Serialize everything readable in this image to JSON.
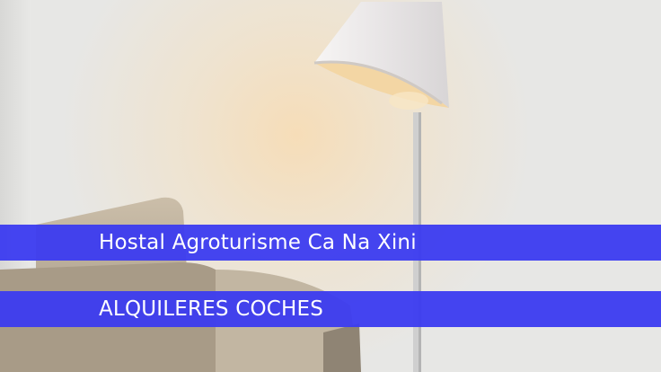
{
  "title": "Hostal Agroturisme Ca Na Xini",
  "subtitle": "ALQUILERES COCHES",
  "colors": {
    "banner": "#3b3bf0",
    "banner_text": "#ffffff",
    "wall": "#e9e8e4",
    "lamp_shade": "#f2f0ee",
    "sofa": "#b8aa95"
  },
  "image_content": [
    "floor lamp",
    "armchair",
    "white wall"
  ]
}
